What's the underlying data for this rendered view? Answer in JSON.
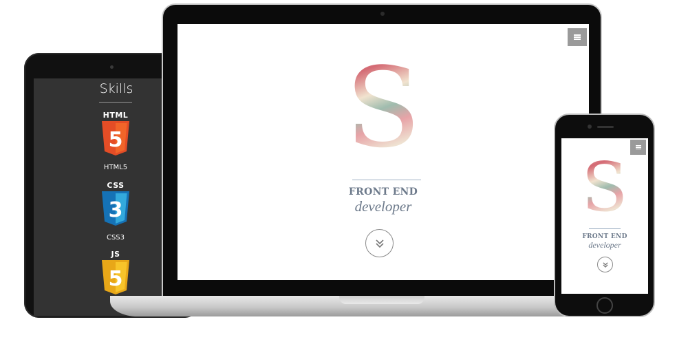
{
  "tablet_site": {
    "section_title": "Skills",
    "skills": [
      {
        "badge": "HTML",
        "numeral": "5",
        "label": "HTML5",
        "color": "#e44d26",
        "shade": "#f16529"
      },
      {
        "badge": "CSS",
        "numeral": "3",
        "label": "CSS3",
        "color": "#1572b6",
        "shade": "#33a9dc"
      },
      {
        "badge": "JS",
        "numeral": "5",
        "label": "",
        "color": "#e8a718",
        "shade": "#f7c42a"
      }
    ]
  },
  "laptop_site": {
    "menu_icon": "hamburger-menu-icon",
    "logo_letter": "S",
    "headline": "FRONT END",
    "subheadline": "developer",
    "scroll_icon": "double-chevron-down-icon"
  },
  "phone_site": {
    "menu_icon": "hamburger-menu-icon",
    "logo_letter": "S",
    "headline": "FRONT END",
    "subheadline": "developer",
    "scroll_icon": "double-chevron-down-icon"
  },
  "colors": {
    "accent_text": "#6d7a8b",
    "menu_button": "#9a9a9a",
    "tablet_background": "#333333"
  }
}
